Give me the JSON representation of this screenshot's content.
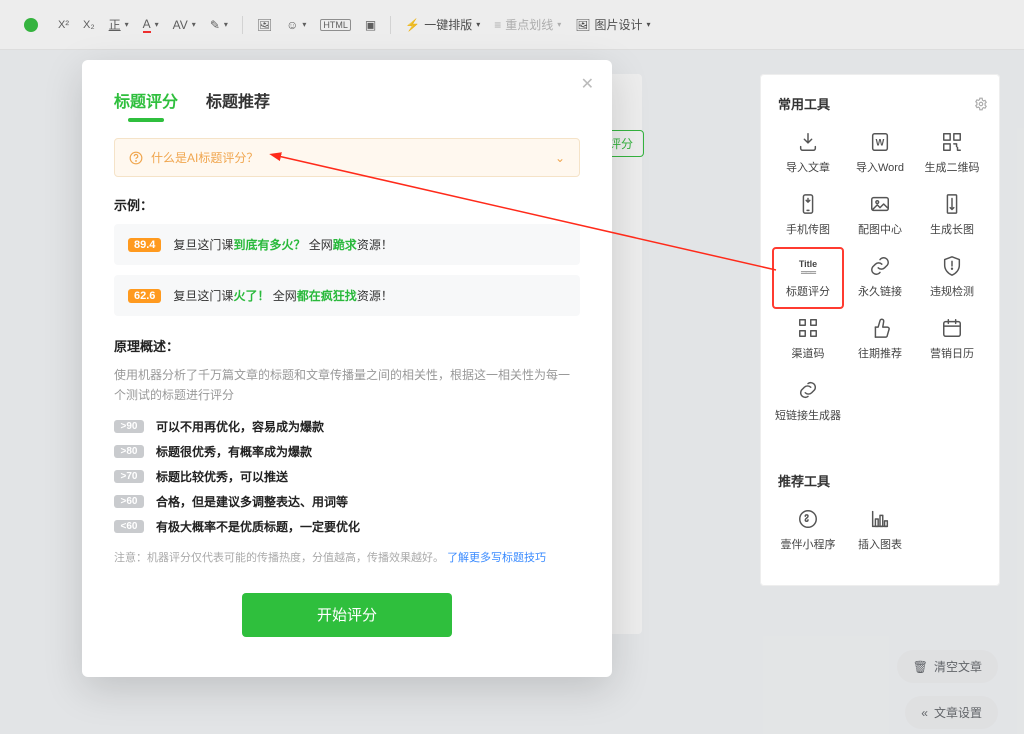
{
  "topbar": {
    "sup": "X²",
    "sub": "X₂",
    "u": "正",
    "a_color": "A",
    "av": "AV",
    "brush": "✎",
    "icons": [
      "img",
      "face",
      "html",
      "video"
    ],
    "format": "一键排版",
    "highlight": "重点划线",
    "image_design": "图片设计"
  },
  "hidden_tag": "评分",
  "modal": {
    "tabs": [
      "标题评分",
      "标题推荐"
    ],
    "active_tab": 0,
    "info_title": "什么是AI标题评分？",
    "example_label": "示例：",
    "examples": [
      {
        "score": "89.4",
        "pre": "复旦这门课",
        "g1": "到底有多火？",
        "mid": "全网",
        "g2": "跪求",
        "suf": "资源！"
      },
      {
        "score": "62.6",
        "pre": "复旦这门课",
        "g1": "火了！",
        "mid": "全网",
        "g2": "都在疯狂找",
        "suf": "资源！"
      }
    ],
    "principle_label": "原理概述：",
    "principle_desc": "使用机器分析了千万篇文章的标题和文章传播量之间的相关性，根据这一相关性为每一个测试的标题进行评分",
    "principle_rows": [
      {
        "badge": ">90",
        "text": "可以不用再优化，容易成为爆款"
      },
      {
        "badge": ">80",
        "text": "标题很优秀，有概率成为爆款"
      },
      {
        "badge": ">70",
        "text": "标题比较优秀，可以推送"
      },
      {
        "badge": ">60",
        "text": "合格，但是建议多调整表达、用词等"
      },
      {
        "badge": "<60",
        "text": "有极大概率不是优质标题，一定要优化"
      }
    ],
    "note_prefix": "注意：机器评分仅代表可能的传播热度，分值越高，传播效果越好。",
    "note_link": "了解更多写标题技巧",
    "cta": "开始评分"
  },
  "sidebar": {
    "title": "常用工具",
    "tools": [
      {
        "name": "导入文章",
        "icon": "download"
      },
      {
        "name": "导入Word",
        "icon": "word"
      },
      {
        "name": "生成二维码",
        "icon": "qr"
      },
      {
        "name": "手机传图",
        "icon": "phone"
      },
      {
        "name": "配图中心",
        "icon": "image"
      },
      {
        "name": "生成长图",
        "icon": "longimg"
      },
      {
        "name": "标题评分",
        "icon": "title"
      },
      {
        "name": "永久链接",
        "icon": "link"
      },
      {
        "name": "违规检测",
        "icon": "shield"
      },
      {
        "name": "渠道码",
        "icon": "channel"
      },
      {
        "name": "往期推荐",
        "icon": "thumb"
      },
      {
        "name": "营销日历",
        "icon": "calendar"
      },
      {
        "name": "短链接生成器",
        "icon": "shortlink"
      }
    ],
    "rec_title": "推荐工具",
    "rec_tools": [
      {
        "name": "壹伴小程序",
        "icon": "miniapp"
      },
      {
        "name": "插入图表",
        "icon": "chart"
      }
    ]
  },
  "chips": {
    "clear": "清空文章",
    "settings": "文章设置"
  },
  "colors": {
    "accent": "#2fbf3d",
    "orange": "#ff9a1f",
    "red": "#ff3b30"
  }
}
